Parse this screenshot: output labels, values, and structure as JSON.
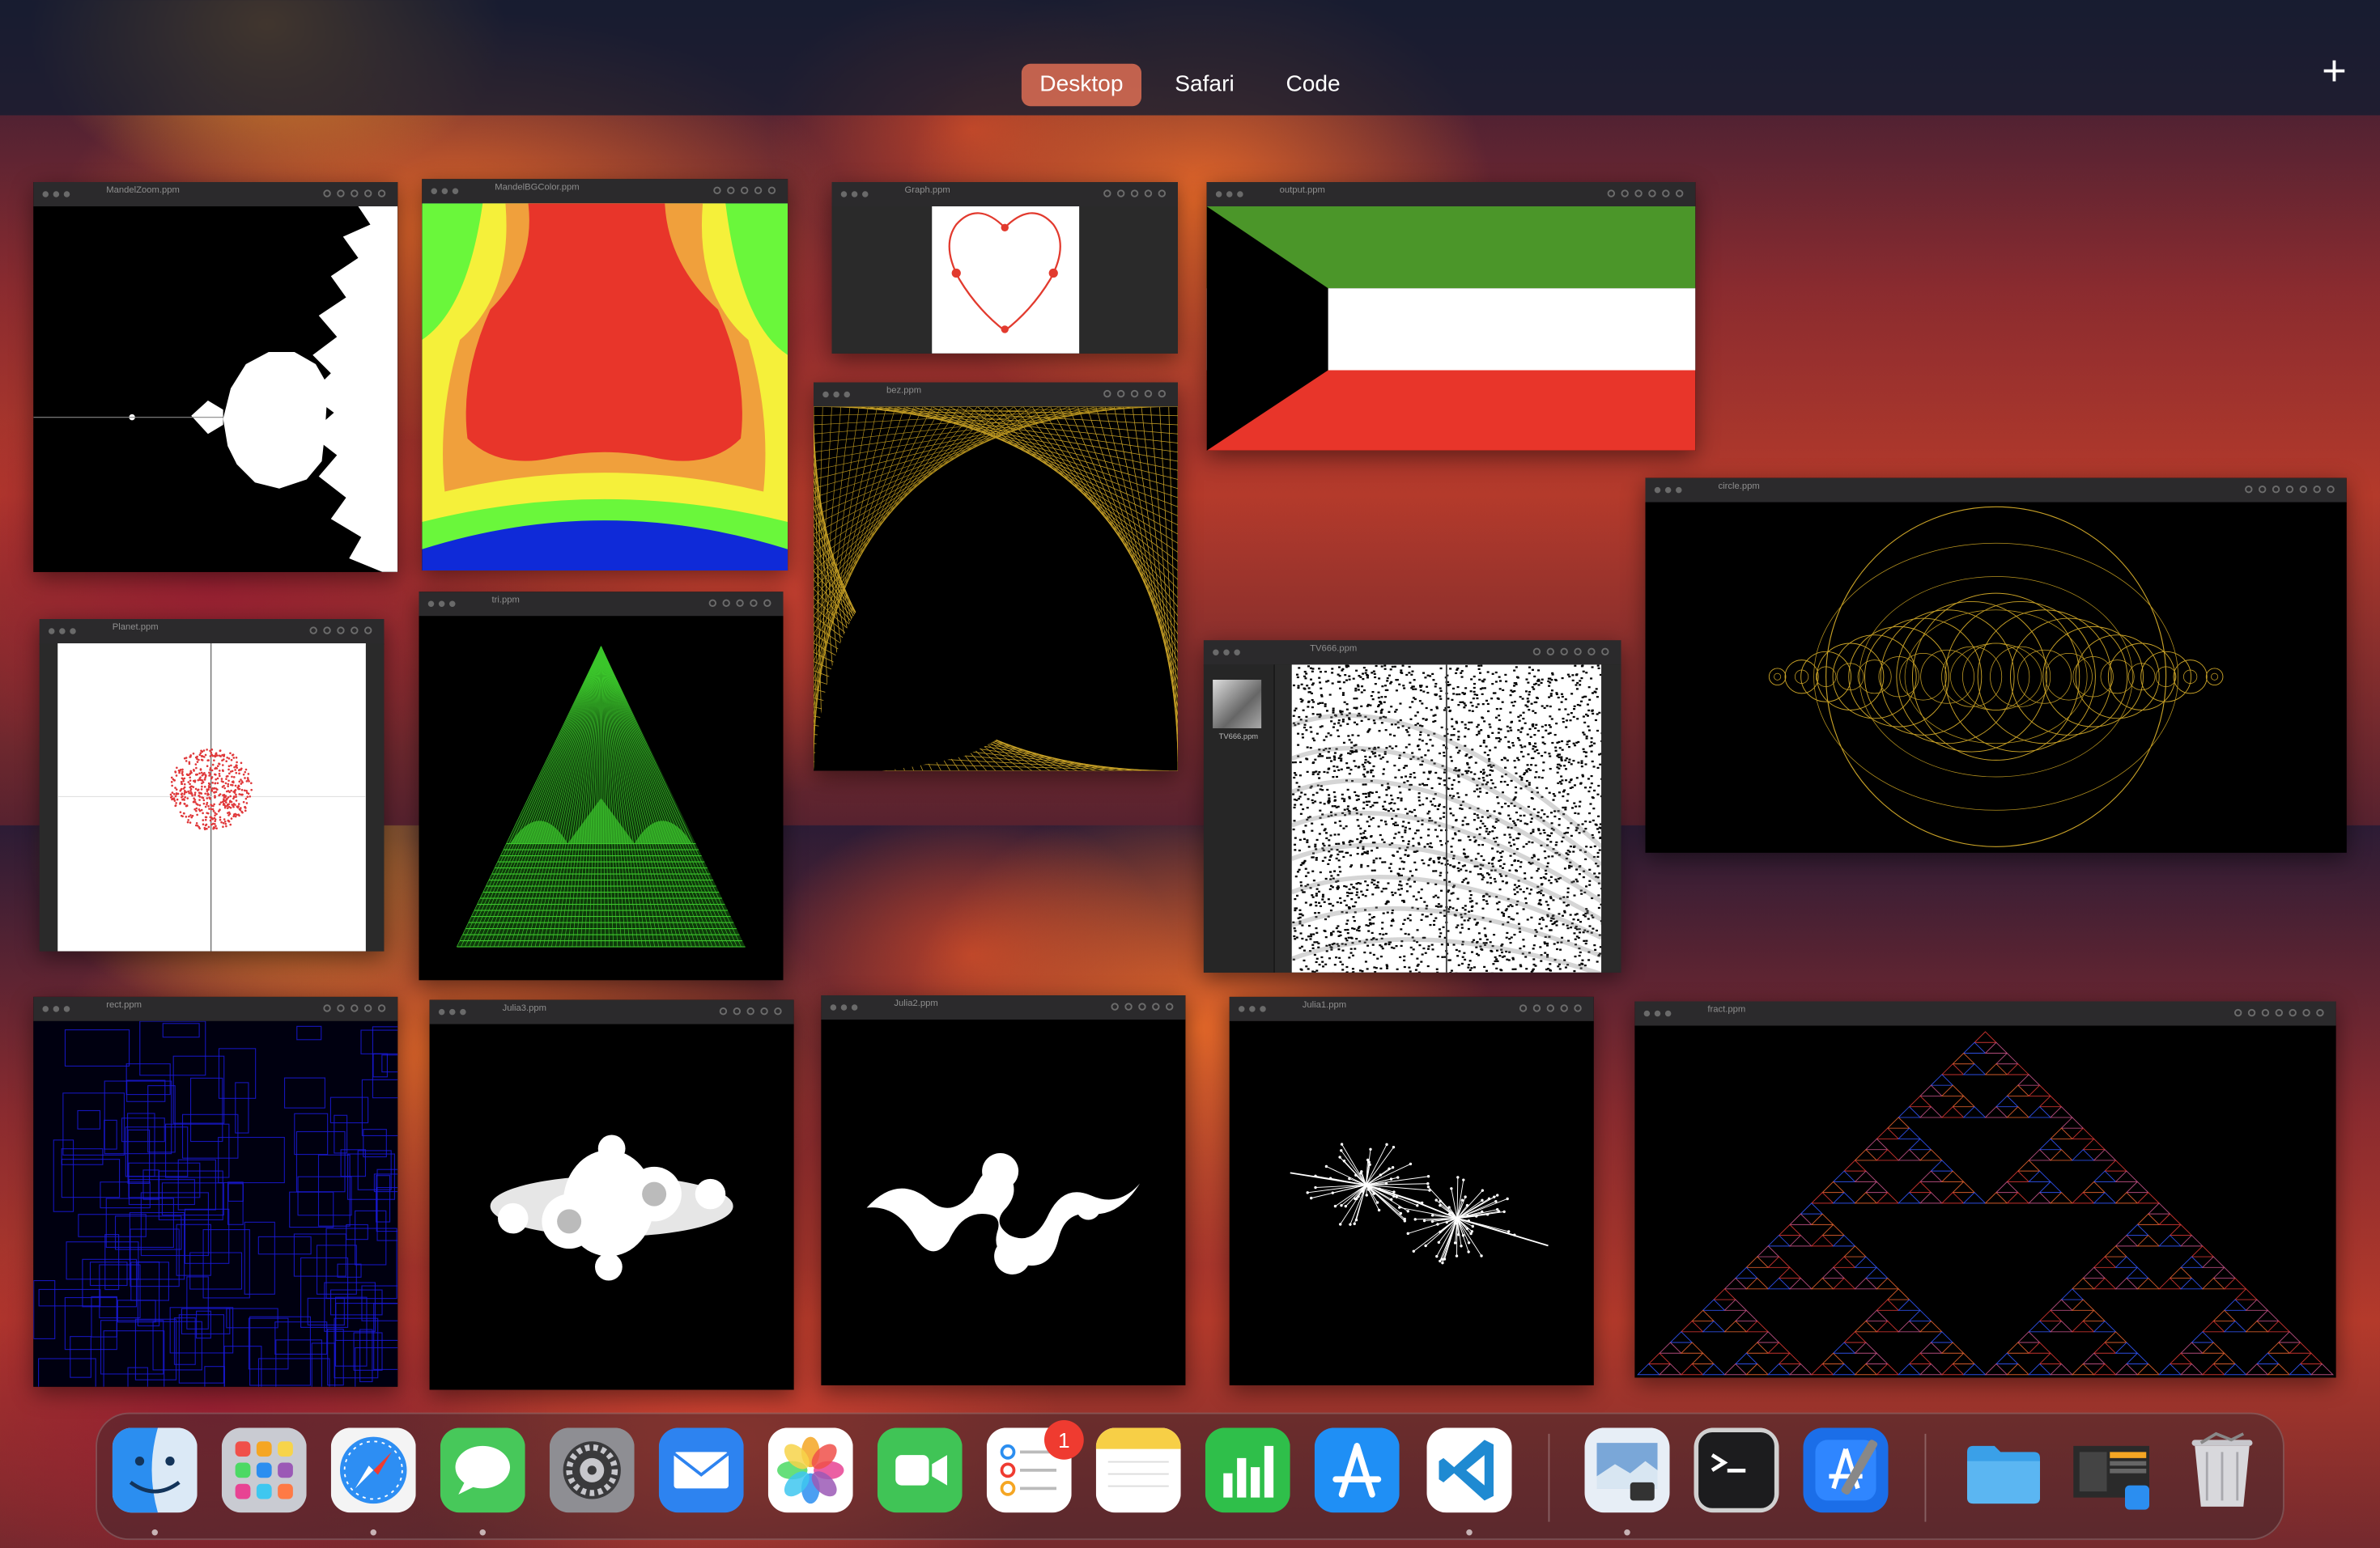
{
  "spaces_bar": {
    "spaces": [
      "Desktop",
      "Safari",
      "Code"
    ],
    "active": "Desktop",
    "add_label": "+"
  },
  "windows": [
    {
      "id": "mandelzoom",
      "filename": "MandelZoom.ppm"
    },
    {
      "id": "mandelbgcolor",
      "filename": "MandelBGColor.ppm"
    },
    {
      "id": "graph",
      "filename": "Graph.ppm"
    },
    {
      "id": "output",
      "filename": "output.ppm"
    },
    {
      "id": "bez",
      "filename": "bez.ppm"
    },
    {
      "id": "circle",
      "filename": "circle.ppm"
    },
    {
      "id": "planet",
      "filename": "Planet.ppm"
    },
    {
      "id": "tri",
      "filename": "tri.ppm"
    },
    {
      "id": "tv",
      "filename": "TV666.ppm",
      "thumbnail_label": "TV666.ppm"
    },
    {
      "id": "rect",
      "filename": "rect.ppm"
    },
    {
      "id": "julia3",
      "filename": "Julia3.ppm"
    },
    {
      "id": "julia2",
      "filename": "Julia2.ppm"
    },
    {
      "id": "julia1",
      "filename": "Julia1.ppm"
    },
    {
      "id": "fract",
      "filename": "fract.ppm"
    }
  ],
  "dock": {
    "apps": [
      {
        "name": "Finder",
        "icon": "finder-icon",
        "running": true
      },
      {
        "name": "Launchpad",
        "icon": "launchpad-icon",
        "running": false
      },
      {
        "name": "Safari",
        "icon": "safari-icon",
        "running": true
      },
      {
        "name": "Messages",
        "icon": "messages-icon",
        "running": true
      },
      {
        "name": "System Settings",
        "icon": "settings-icon",
        "running": false
      },
      {
        "name": "Mail",
        "icon": "mail-icon",
        "running": false
      },
      {
        "name": "Photos",
        "icon": "photos-icon",
        "running": false
      },
      {
        "name": "FaceTime",
        "icon": "facetime-icon",
        "running": false
      },
      {
        "name": "Reminders",
        "icon": "reminders-icon",
        "running": false,
        "badge": "1"
      },
      {
        "name": "Notes",
        "icon": "notes-icon",
        "running": false
      },
      {
        "name": "Numbers",
        "icon": "numbers-icon",
        "running": false
      },
      {
        "name": "App Store",
        "icon": "appstore-icon",
        "running": false
      },
      {
        "name": "Visual Studio Code",
        "icon": "vscode-icon",
        "running": true
      },
      {
        "name": "Preview",
        "icon": "preview-icon",
        "running": true
      },
      {
        "name": "Terminal",
        "icon": "terminal-icon",
        "running": false
      },
      {
        "name": "Xcode",
        "icon": "xcode-icon",
        "running": false
      },
      {
        "name": "Folder",
        "icon": "folder-icon",
        "running": false
      },
      {
        "name": "Recent Screen",
        "icon": "screenshot-icon",
        "running": false
      },
      {
        "name": "Trash",
        "icon": "trash-icon",
        "running": false
      }
    ]
  },
  "colors": {
    "active_space": "#f4785a",
    "window_toolbar": "#2b2a2c",
    "badge": "#ef3b30"
  }
}
